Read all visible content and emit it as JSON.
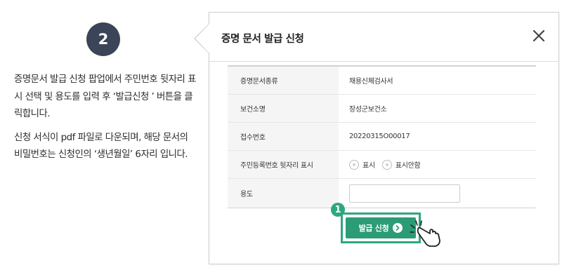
{
  "guide": {
    "step_number": "2",
    "paragraph1": "증명문서 발급 신청 팝업에서 주민번호 뒷자리 표시 선택 및 용도를 입력 후 ‘발급신청 ’ 버튼을 클릭합니다.",
    "paragraph2": "신청 서식이 pdf 파일로 다운되며, 해당 문서의 비밀번호는 신청인의 ‘생년월일’ 6자리 입니다."
  },
  "popup": {
    "title": "증명 문서 발급 신청",
    "rows": [
      {
        "label": "증명문서종류",
        "value": "채용신체검사서"
      },
      {
        "label": "보건소명",
        "value": "장성군보건소"
      },
      {
        "label": "접수번호",
        "value": "20220315O00017"
      }
    ],
    "ssn_row": {
      "label": "주민등록번호 뒷자리 표시",
      "option_show": "표시",
      "option_hide": "표시안함"
    },
    "purpose_row": {
      "label": "용도",
      "value": ""
    },
    "submit_label": "발급 신청",
    "marker": "1"
  },
  "colors": {
    "accent_green": "#2b9c76",
    "badge_dark": "#3c4457"
  }
}
